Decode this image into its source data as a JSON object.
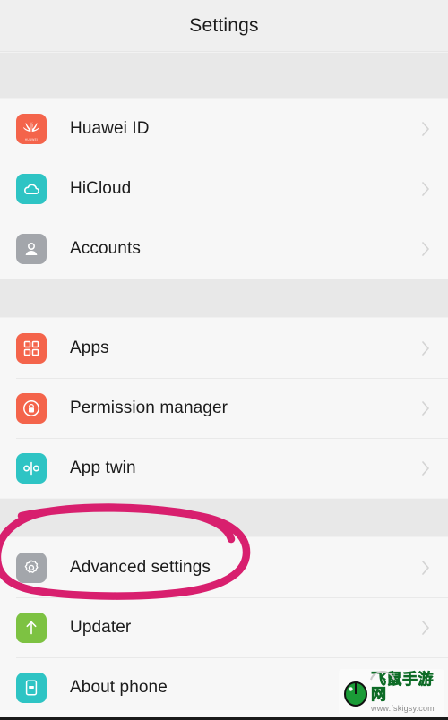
{
  "header": {
    "title": "Settings"
  },
  "colors": {
    "page_background": "#f7f7f7",
    "header_background": "#efefef",
    "group_spacer": "#e8e8e8",
    "divider": "#e9e9e9",
    "primary_text": "#1b1b1b",
    "chevron": "#b9b9b9",
    "annotation_pink": "#d81f6e",
    "icon_coral": "#f4644b",
    "icon_teal": "#2ec4c4",
    "icon_gray": "#a3a6ab",
    "icon_green": "#7dc242",
    "watermark_green": "#18a03a"
  },
  "groups": [
    {
      "name": "account-group",
      "items": [
        {
          "label": "Huawei ID",
          "icon": "huawei-logo-icon",
          "icon_color": "#f4644b",
          "chevron": true
        },
        {
          "label": "HiCloud",
          "icon": "cloud-icon",
          "icon_color": "#2ec4c4",
          "chevron": true
        },
        {
          "label": "Accounts",
          "icon": "person-icon",
          "icon_color": "#a3a6ab",
          "chevron": true
        }
      ]
    },
    {
      "name": "apps-group",
      "items": [
        {
          "label": "Apps",
          "icon": "app-grid-icon",
          "icon_color": "#f4644b",
          "chevron": true
        },
        {
          "label": "Permission manager",
          "icon": "lock-circle-icon",
          "icon_color": "#f4644b",
          "chevron": true
        },
        {
          "label": "App twin",
          "icon": "app-twin-icon",
          "icon_color": "#2ec4c4",
          "chevron": true
        }
      ]
    },
    {
      "name": "system-group",
      "items": [
        {
          "label": "Advanced settings",
          "icon": "gear-icon",
          "icon_color": "#a3a6ab",
          "chevron": true
        },
        {
          "label": "Updater",
          "icon": "arrow-up-icon",
          "icon_color": "#7dc242",
          "chevron": true
        },
        {
          "label": "About phone",
          "icon": "phone-info-icon",
          "icon_color": "#2ec4c4",
          "chevron": false
        }
      ]
    }
  ],
  "annotation": {
    "shape": "hand-drawn-ellipse",
    "target_label": "Advanced settings",
    "color": "#d81f6e"
  },
  "watermark": {
    "brand_cn": "飞鼠手游网",
    "url": "www.fskigsy.com",
    "icon": "mouse-icon"
  },
  "icons": {
    "huawei_brand_text": "HUAWEI"
  }
}
